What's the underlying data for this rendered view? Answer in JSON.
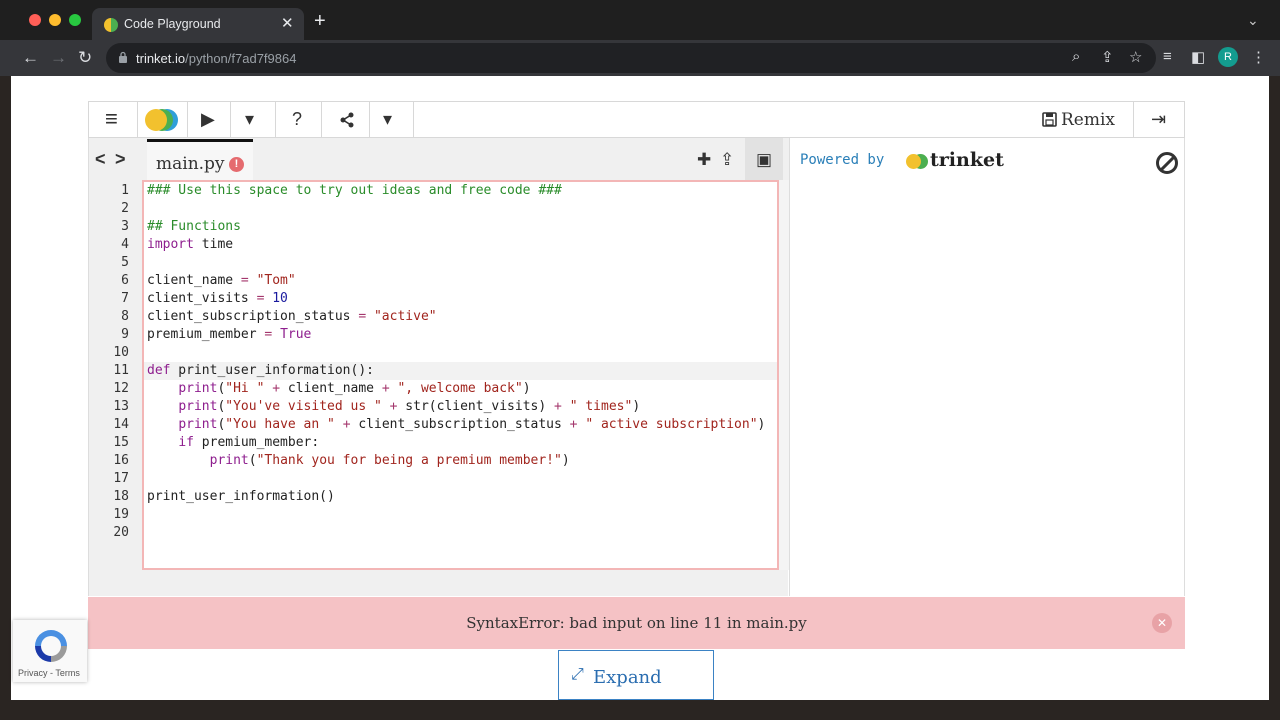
{
  "browser": {
    "tab_title": "Code Playground",
    "tab_close": "✕",
    "new_tab": "+",
    "url_host": "trinket.io",
    "url_path": "/python/f7ad7f9864",
    "avatar_letter": "R",
    "nav_back": "←",
    "nav_forward": "→",
    "nav_reload": "↻",
    "tab_search": "⌄",
    "addr_icons": [
      "⌕",
      "⇪",
      "☆",
      "≡",
      "◧",
      "⋮"
    ]
  },
  "toolbar": {
    "menu_icon": "≡",
    "run_icon": "▶",
    "dropdown_icon": "▾",
    "help_icon": "?",
    "share_icon": "⋖",
    "share_dropdown_icon": "▾",
    "remix_label": "Remix",
    "signin_icon": "⇥"
  },
  "editor": {
    "nav_prev": "<",
    "nav_next": ">",
    "file_name": "main.py",
    "error_badge": "!",
    "add_icon": "✚",
    "upload_icon": "⇪",
    "image_icon": "▣",
    "lines": [
      {
        "n": "1",
        "html": "<span class=\"cm\">### Use this space to try out ideas and free code ###</span>"
      },
      {
        "n": "2",
        "html": ""
      },
      {
        "n": "3",
        "html": "<span class=\"cm\">## Functions</span>"
      },
      {
        "n": "4",
        "html": "<span class=\"kw\">import</span> time"
      },
      {
        "n": "5",
        "html": ""
      },
      {
        "n": "6",
        "html": "client_name <span class=\"op\">=</span> <span class=\"str\">\"Tom\"</span>"
      },
      {
        "n": "7",
        "html": "client_visits <span class=\"op\">=</span> <span class=\"num\">10</span>"
      },
      {
        "n": "8",
        "html": "client_subscription_status <span class=\"op\">=</span> <span class=\"str\">\"active\"</span>"
      },
      {
        "n": "9",
        "html": "premium_member <span class=\"op\">=</span> <span class=\"kw\">True</span>"
      },
      {
        "n": "10",
        "html": ""
      },
      {
        "n": "11",
        "html": "<span class=\"kw\">def</span> print_user_information():"
      },
      {
        "n": "12",
        "html": "    <span class=\"kw\">print</span>(<span class=\"str\">\"Hi \"</span> <span class=\"op\">+</span> client_name <span class=\"op\">+</span> <span class=\"str\">\", welcome back\"</span>)"
      },
      {
        "n": "13",
        "html": "    <span class=\"kw\">print</span>(<span class=\"str\">\"You've visited us \"</span> <span class=\"op\">+</span> str(client_visits) <span class=\"op\">+</span> <span class=\"str\">\" times\"</span>)"
      },
      {
        "n": "14",
        "html": "    <span class=\"kw\">print</span>(<span class=\"str\">\"You have an \"</span> <span class=\"op\">+</span> client_subscription_status <span class=\"op\">+</span> <span class=\"str\">\" active subscription\"</span>)"
      },
      {
        "n": "15",
        "html": "    <span class=\"kw\">if</span> premium_member:"
      },
      {
        "n": "16",
        "html": "        <span class=\"kw\">print</span>(<span class=\"str\">\"Thank you for being a premium member!\"</span>)"
      },
      {
        "n": "17",
        "html": ""
      },
      {
        "n": "18",
        "html": "print_user_information()"
      },
      {
        "n": "19",
        "html": ""
      },
      {
        "n": "20",
        "html": ""
      }
    ]
  },
  "output": {
    "powered_by": "Powered by",
    "brand": "trinket"
  },
  "error": {
    "message": "SyntaxError: bad input on line 11 in main.py",
    "close_icon": "✕"
  },
  "expand": {
    "label": "Expand",
    "icon": "⤢"
  },
  "recaptcha": {
    "privacy": "Privacy - Terms"
  }
}
